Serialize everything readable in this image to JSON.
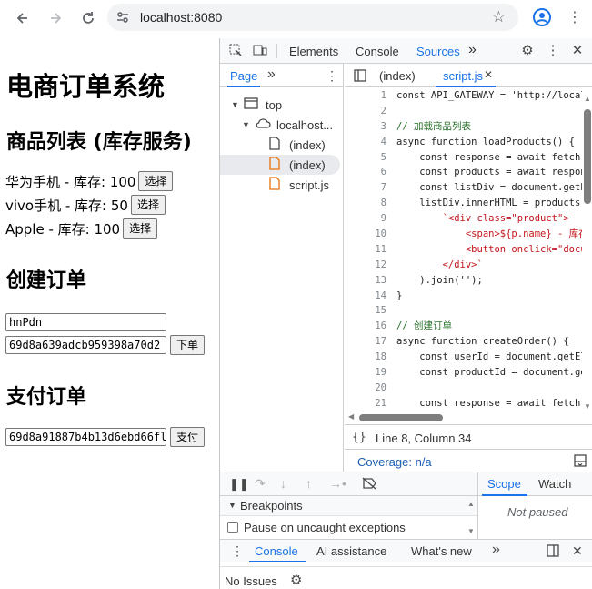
{
  "browser": {
    "url": "localhost:8080",
    "back_icon": "arrow-left-icon",
    "forward_icon": "arrow-right-icon",
    "reload_icon": "reload-icon"
  },
  "page": {
    "title": "电商订单系统",
    "products_heading": "商品列表 (库存服务)",
    "products": [
      {
        "text": "华为手机 - 库存: 100",
        "button": "选择"
      },
      {
        "text": "vivo手机 - 库存: 50",
        "button": "选择"
      },
      {
        "text": "Apple - 库存: 100",
        "button": "选择"
      }
    ],
    "create_heading": "创建订单",
    "user_id_value": "hnPdn",
    "product_id_value": "69d8a639adcb959398a70d2",
    "order_button": "下单",
    "pay_heading": "支付订单",
    "order_id_value": "69d8a91887b4b13d6ebd66fl",
    "pay_button": "支付"
  },
  "devtools": {
    "tabs": [
      "Elements",
      "Console",
      "Sources"
    ],
    "active_tab": "Sources",
    "more": "»",
    "navigator": {
      "page_tab": "Page",
      "more": "»",
      "tree": [
        {
          "label": "top",
          "icon": "frame-icon"
        },
        {
          "label": "localhost...",
          "icon": "cloud-icon"
        },
        {
          "label": "(index)",
          "icon": "file-icon"
        },
        {
          "label": "(index)",
          "icon": "file-html-icon"
        },
        {
          "label": "script.js",
          "icon": "file-js-icon"
        }
      ]
    },
    "editor": {
      "tabs": [
        "(index)",
        "script.js"
      ],
      "active_tab": "script.js",
      "line_numbers": [
        "1",
        "2",
        "3",
        "4",
        "5",
        "6",
        "7",
        "8",
        "9",
        "10",
        "11",
        "12",
        "13",
        "14",
        "15",
        "16",
        "17",
        "18",
        "19",
        "20",
        "21"
      ],
      "lines": [
        "const API_GATEWAY = 'http://localh",
        "",
        "// 加载商品列表",
        "async function loadProducts() {",
        "    const response = await fetch(`",
        "    const products = await respons",
        "    const listDiv = document.getEl",
        "    listDiv.innerHTML = products.m",
        "        `<div class=\"product\">",
        "            <span>${p.name} - 库存",
        "            <button onclick=\"docum",
        "        </div>`",
        "    ).join('');",
        "}",
        "",
        "// 创建订单",
        "async function createOrder() {",
        "    const userId = document.getEle",
        "    const productId = document.get",
        "",
        "    const response = await fetch("
      ],
      "status_position": "Line 8, Column 34",
      "coverage": "Coverage: n/a"
    },
    "debugger": {
      "breakpoints_label": "Breakpoints",
      "pause_uncaught": "Pause on uncaught exceptions",
      "scope_tab": "Scope",
      "watch_tab": "Watch",
      "not_paused": "Not paused"
    },
    "drawer": {
      "tabs": [
        "Console",
        "AI assistance",
        "What's new"
      ],
      "active_tab": "Console",
      "more": "»",
      "issues": "No Issues"
    }
  },
  "colors": {
    "accent": "#1a73e8",
    "file_orange": "#e8710a",
    "comment": "#236e25",
    "keyword": "#9b27a8",
    "string": "#c4161c",
    "function": "#1a1aa6"
  }
}
